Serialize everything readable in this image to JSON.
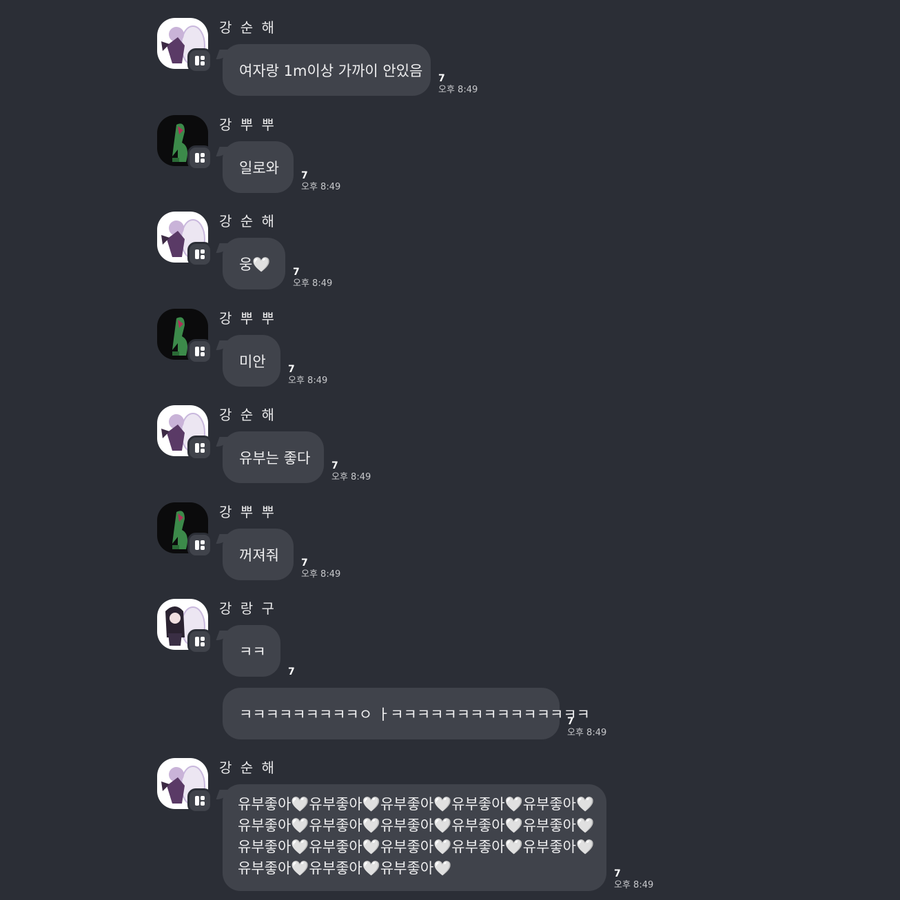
{
  "messages": [
    {
      "sender": "강 순 해",
      "avatar": "purple-character",
      "text": "여자랑 1m이상 가까이 안있음",
      "unread": "7",
      "time": "오후 8:49"
    },
    {
      "sender": "강 뿌 뿌",
      "avatar": "green-dinosaur",
      "text": "일로와",
      "unread": "7",
      "time": "오후 8:49"
    },
    {
      "sender": "강 순 해",
      "avatar": "purple-character",
      "text": "웅🤍",
      "unread": "7",
      "time": "오후 8:49"
    },
    {
      "sender": "강 뿌 뿌",
      "avatar": "green-dinosaur",
      "text": "미안",
      "unread": "7",
      "time": "오후 8:49"
    },
    {
      "sender": "강 순 해",
      "avatar": "purple-character",
      "text": "유부는 좋다",
      "unread": "7",
      "time": "오후 8:49"
    },
    {
      "sender": "강 뿌 뿌",
      "avatar": "green-dinosaur",
      "text": "꺼져줘",
      "unread": "7",
      "time": "오후 8:49"
    },
    {
      "sender": "강 랑 구",
      "avatar": "dark-hair-character",
      "text": "ㅋㅋ",
      "unread": "7",
      "time": ""
    },
    {
      "sender": "",
      "avatar": "",
      "text": "ㅋㅋㅋㅋㅋㅋㅋㅋㅋㅇ ㅏㅋㅋㅋㅋㅋㅋㅋㅋㅋㅋㅋㅋㅋㅋㅋ",
      "unread": "7",
      "time": "오후 8:49"
    },
    {
      "sender": "강 순 해",
      "avatar": "purple-character",
      "lines": [
        "유부좋아🤍유부좋아🤍유부좋아🤍유부좋아🤍유부좋아🤍",
        "유부좋아🤍유부좋아🤍유부좋아🤍유부좋아🤍유부좋아🤍",
        "유부좋아🤍유부좋아🤍유부좋아🤍유부좋아🤍유부좋아🤍",
        "유부좋아🤍유부좋아🤍유부좋아🤍"
      ],
      "unread": "7",
      "time": "오후 8:49"
    }
  ]
}
